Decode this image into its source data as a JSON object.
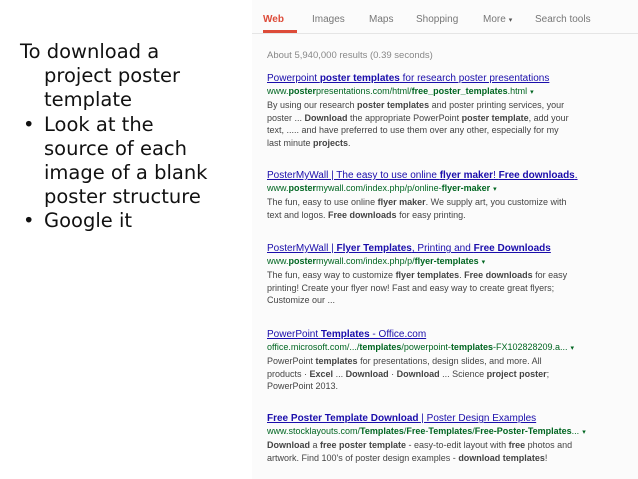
{
  "slide": {
    "heading_line1": "To download a",
    "heading_line2": "project poster",
    "heading_line3": "template",
    "bullets": [
      {
        "lines": [
          "Look at the",
          "source of each",
          "image of a blank",
          "poster structure"
        ]
      },
      {
        "lines": [
          "Google it"
        ]
      }
    ],
    "bullet_glyph": "•"
  },
  "search": {
    "tabs": [
      "Web",
      "Images",
      "Maps",
      "Shopping",
      "More",
      "Search tools"
    ],
    "more_caret": "▾",
    "stats": "About 5,940,000 results (0.39 seconds)",
    "results": [
      {
        "title": [
          {
            "t": "Powerpoint "
          },
          {
            "t": "poster templates",
            "b": true
          },
          {
            "t": " for research poster presentations"
          }
        ],
        "url": [
          {
            "t": "www."
          },
          {
            "t": "poster",
            "b": true
          },
          {
            "t": "presentations.com/html/"
          },
          {
            "t": "free_poster_templates",
            "b": true
          },
          {
            "t": ".html"
          }
        ],
        "snippet": [
          [
            {
              "t": "By using our research "
            },
            {
              "t": "poster templates",
              "b": true
            },
            {
              "t": " and poster printing services, your"
            }
          ],
          [
            {
              "t": "poster ... "
            },
            {
              "t": "Download",
              "b": true
            },
            {
              "t": " the appropriate PowerPoint "
            },
            {
              "t": "poster template",
              "b": true
            },
            {
              "t": ", add your"
            }
          ],
          [
            {
              "t": "text, ..... and have preferred to use them over any other, especially for my"
            }
          ],
          [
            {
              "t": "last minute "
            },
            {
              "t": "projects",
              "b": true
            },
            {
              "t": "."
            }
          ]
        ]
      },
      {
        "title": [
          {
            "t": "PosterMyWall | The easy to use online "
          },
          {
            "t": "flyer maker",
            "b": true
          },
          {
            "t": "! "
          },
          {
            "t": "Free downloads",
            "b": true
          },
          {
            "t": "."
          }
        ],
        "url": [
          {
            "t": "www."
          },
          {
            "t": "poster",
            "b": true
          },
          {
            "t": "mywall.com/index.php/p/online-"
          },
          {
            "t": "flyer-maker",
            "b": true
          }
        ],
        "snippet": [
          [
            {
              "t": "The fun, easy to use online "
            },
            {
              "t": "flyer maker",
              "b": true
            },
            {
              "t": ". We supply art, you customize with"
            }
          ],
          [
            {
              "t": "text and logos. "
            },
            {
              "t": "Free downloads",
              "b": true
            },
            {
              "t": " for easy printing."
            }
          ]
        ]
      },
      {
        "title": [
          {
            "t": "PosterMyWall | "
          },
          {
            "t": "Flyer Templates",
            "b": true
          },
          {
            "t": ", Printing and "
          },
          {
            "t": "Free Downloads",
            "b": true
          }
        ],
        "url": [
          {
            "t": "www."
          },
          {
            "t": "poster",
            "b": true
          },
          {
            "t": "mywall.com/index.php/p/"
          },
          {
            "t": "flyer-templates",
            "b": true
          }
        ],
        "snippet": [
          [
            {
              "t": "The fun, easy way to customize "
            },
            {
              "t": "flyer templates",
              "b": true
            },
            {
              "t": ". "
            },
            {
              "t": "Free downloads",
              "b": true
            },
            {
              "t": " for easy"
            }
          ],
          [
            {
              "t": "printing! Create your flyer now! Fast and easy way to create great flyers;"
            }
          ],
          [
            {
              "t": "Customize our ..."
            }
          ]
        ]
      },
      {
        "title": [
          {
            "t": "PowerPoint "
          },
          {
            "t": "Templates",
            "b": true
          },
          {
            "t": " - Office.com"
          }
        ],
        "url": [
          {
            "t": "office.microsoft.com/.../"
          },
          {
            "t": "templates",
            "b": true
          },
          {
            "t": "/powerpoint-"
          },
          {
            "t": "templates",
            "b": true
          },
          {
            "t": "-FX102828209.a..."
          }
        ],
        "snippet": [
          [
            {
              "t": "PowerPoint "
            },
            {
              "t": "templates",
              "b": true
            },
            {
              "t": " for presentations, design slides, and more. All"
            }
          ],
          [
            {
              "t": "products · "
            },
            {
              "t": "Excel",
              "b": true
            },
            {
              "t": " ... "
            },
            {
              "t": "Download",
              "b": true
            },
            {
              "t": " · "
            },
            {
              "t": "Download",
              "b": true
            },
            {
              "t": " ... Science "
            },
            {
              "t": "project poster",
              "b": true
            },
            {
              "t": ";"
            }
          ],
          [
            {
              "t": "PowerPoint 2013."
            }
          ]
        ]
      },
      {
        "title": [
          {
            "t": "Free Poster Template Download",
            "b": true
          },
          {
            "t": " | Poster Design Examples"
          }
        ],
        "url": [
          {
            "t": "www.stocklayouts.com/"
          },
          {
            "t": "Templates",
            "b": true
          },
          {
            "t": "/"
          },
          {
            "t": "Free",
            "b": true
          },
          {
            "t": "-"
          },
          {
            "t": "Templates",
            "b": true
          },
          {
            "t": "/"
          },
          {
            "t": "Free-Poster-Templates",
            "b": true
          },
          {
            "t": "..."
          }
        ],
        "snippet": [
          [
            {
              "t": "Download",
              "b": true
            },
            {
              "t": " a "
            },
            {
              "t": "free poster template",
              "b": true
            },
            {
              "t": " - easy-to-edit layout with "
            },
            {
              "t": "free",
              "b": true
            },
            {
              "t": " photos and"
            }
          ],
          [
            {
              "t": "artwork. Find 100's of poster design examples - "
            },
            {
              "t": "download templates",
              "b": true
            },
            {
              "t": "!"
            }
          ]
        ]
      }
    ],
    "url_caret": "▾"
  },
  "colors": {
    "accent": "#dd4b39",
    "link": "#1a0dab",
    "url": "#006621",
    "snippet": "#444444",
    "stats": "#888888"
  }
}
